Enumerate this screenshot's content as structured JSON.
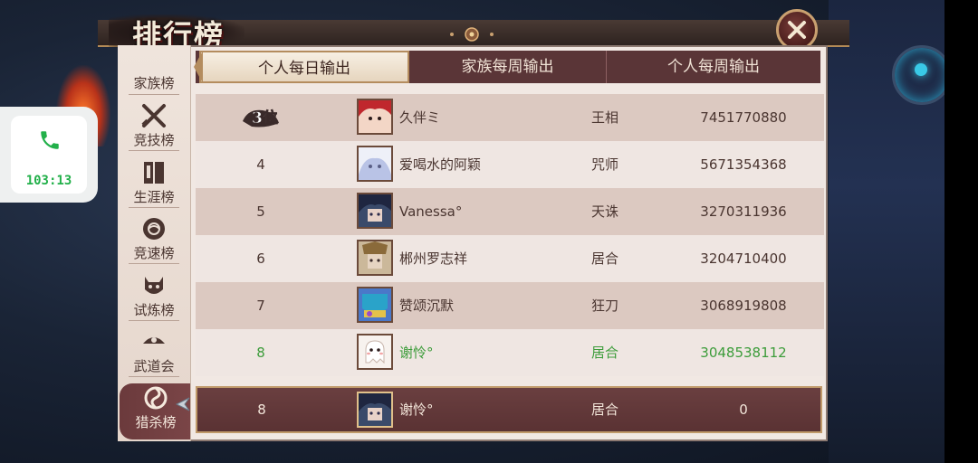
{
  "title": "排行榜",
  "call": {
    "time": "103:13"
  },
  "colors": {
    "accent": "#5a3537",
    "self_text": "#3c9c3a",
    "panel": "#f1e8e3"
  },
  "sidebar": {
    "items": [
      {
        "label": "家族榜",
        "icon": "family-flag-icon"
      },
      {
        "label": "竞技榜",
        "icon": "crossed-swords-icon"
      },
      {
        "label": "生涯榜",
        "icon": "book-icon"
      },
      {
        "label": "竞速榜",
        "icon": "drum-icon"
      },
      {
        "label": "试炼榜",
        "icon": "demon-mask-icon"
      },
      {
        "label": "武道会",
        "icon": "dojo-icon"
      },
      {
        "label": "猎杀榜",
        "icon": "swirl-blade-icon",
        "active": true
      }
    ]
  },
  "tabs": [
    {
      "label": "个人每日输出",
      "active": true
    },
    {
      "label": "家族每周输出"
    },
    {
      "label": "个人每周输出"
    }
  ],
  "rows": [
    {
      "rank": "3位",
      "name": "久伴ミ",
      "class": "王相",
      "score": "7451770880",
      "avatar": "red-hair-avatar"
    },
    {
      "rank": "4",
      "name": "爱喝水的阿颖",
      "class": "咒师",
      "score": "5671354368",
      "avatar": "white-hair-avatar"
    },
    {
      "rank": "5",
      "name": "Vanessa°",
      "class": "天诛",
      "score": "3270311936",
      "avatar": "dark-hair-avatar"
    },
    {
      "rank": "6",
      "name": "郴州罗志祥",
      "class": "居合",
      "score": "3204710400",
      "avatar": "armored-avatar"
    },
    {
      "rank": "7",
      "name": "赞颂沉默",
      "class": "狂刀",
      "score": "3068919808",
      "avatar": "blue-mask-avatar"
    },
    {
      "rank": "8",
      "name": "谢怜°",
      "class": "居合",
      "score": "3048538112",
      "avatar": "ghost-avatar",
      "self": true
    }
  ],
  "my_row": {
    "rank": "8",
    "name": "谢怜°",
    "class": "居合",
    "score": "0",
    "avatar": "dark-hair-avatar"
  }
}
